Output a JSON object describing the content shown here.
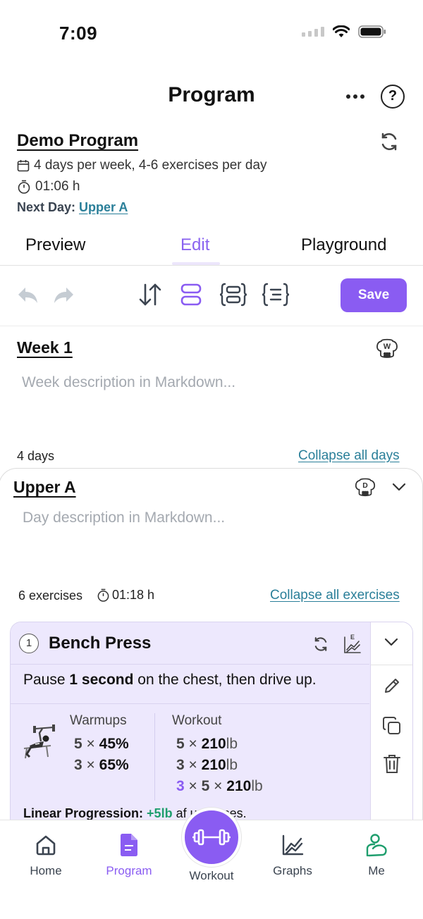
{
  "status_bar": {
    "time": "7:09"
  },
  "header": {
    "title": "Program",
    "help_label": "?"
  },
  "program": {
    "name": "Demo Program",
    "schedule": "4 days per week, 4-6 exercises per day",
    "duration": "01:06 h",
    "next_day_label": "Next Day: ",
    "next_day_value": "Upper A"
  },
  "tabs": [
    {
      "label": "Preview",
      "active": false
    },
    {
      "label": "Edit",
      "active": true
    },
    {
      "label": "Playground",
      "active": false
    }
  ],
  "toolbar": {
    "save_label": "Save"
  },
  "week": {
    "title": "Week 1",
    "icon_letter": "W",
    "description_placeholder": "Week description in Markdown...",
    "days_count": "4 days",
    "collapse_label": "Collapse all days"
  },
  "day": {
    "title": "Upper A",
    "icon_letter": "D",
    "description_placeholder": "Day description in Markdown...",
    "exercises_count": "6 exercises",
    "duration": "01:18 h",
    "collapse_label": "Collapse all exercises"
  },
  "exercise": {
    "number": "1",
    "name": "Bench Press",
    "graph_letter": "E",
    "note_pre": "Pause ",
    "note_bold": "1 second",
    "note_post": " on the chest, then drive up.",
    "warmups_label": "Warmups",
    "workout_label": "Workout",
    "warmups": [
      {
        "reps": "5",
        "x": "×",
        "value": "45%"
      },
      {
        "reps": "3",
        "x": "×",
        "value": "65%"
      }
    ],
    "workout": [
      {
        "reps": "5",
        "x": "×",
        "weight": "210",
        "unit": "lb"
      },
      {
        "reps": "3",
        "x": "×",
        "weight": "210",
        "unit": "lb"
      },
      {
        "sets": "3",
        "reps": "5",
        "x": "×",
        "weight": "210",
        "unit": "lb"
      }
    ],
    "progression_label": "Linear Progression: ",
    "progression_value": "+5lb",
    "progression_rest": " af     uccesses."
  },
  "bottom_nav": {
    "home": "Home",
    "program": "Program",
    "workout": "Workout",
    "graphs": "Graphs",
    "me": "Me"
  },
  "colors": {
    "accent": "#8a5cf2",
    "link": "#2a7f99",
    "success": "#1e9e6d",
    "card_bg": "#ede8fd"
  }
}
